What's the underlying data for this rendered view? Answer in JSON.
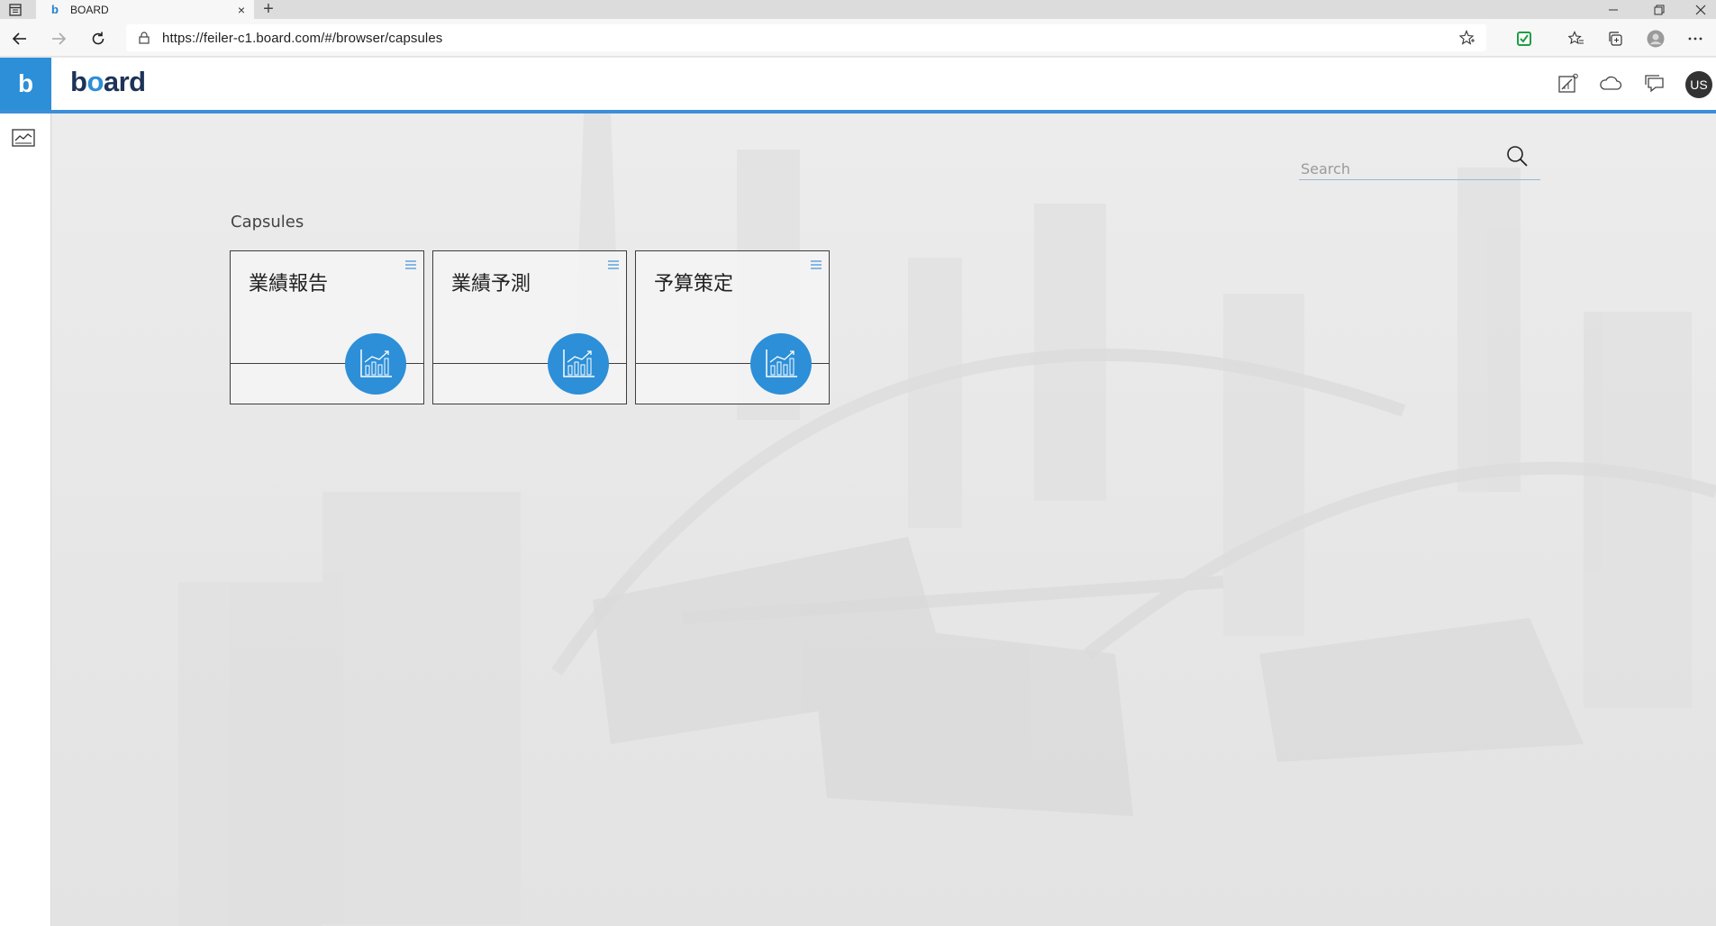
{
  "browser": {
    "tab_title": "BOARD",
    "url": "https://feiler-c1.board.com/#/browser/capsules",
    "new_tab_symbol": "+",
    "close_symbol": "×"
  },
  "app": {
    "brand_prefix": "b",
    "brand_o": "o",
    "brand_suffix": "ard",
    "logo_letter": "b",
    "user_initials": "US",
    "accent_color": "#2c8fd8"
  },
  "search": {
    "placeholder": "Search"
  },
  "capsules": {
    "section_title": "Capsules",
    "items": [
      {
        "label": "業績報告",
        "icon": "chart-icon"
      },
      {
        "label": "業績予測",
        "icon": "chart-icon"
      },
      {
        "label": "予算策定",
        "icon": "chart-icon"
      }
    ]
  }
}
